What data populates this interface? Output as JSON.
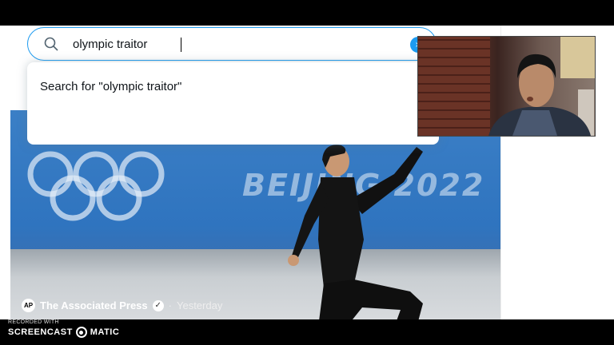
{
  "search": {
    "value": "olympic traitor",
    "suggestion": "Search for \"olympic traitor\"",
    "clear_label": "×"
  },
  "news": {
    "banner_text": "BEIJING 2022",
    "source": "The Associated Press",
    "source_logo": "AP",
    "verified_mark": "✓",
    "separator": "·",
    "time": "Yesterday"
  },
  "recorder": {
    "recorded_with": "RECORDED WITH",
    "brand_left": "SCREENCAST",
    "brand_right": "MATIC"
  },
  "colors": {
    "accent": "#1d9bf0",
    "photo_blue": "#2f74bf"
  },
  "icons": {
    "search": "search-icon",
    "clear": "close-icon",
    "verified": "verified-badge-icon"
  }
}
